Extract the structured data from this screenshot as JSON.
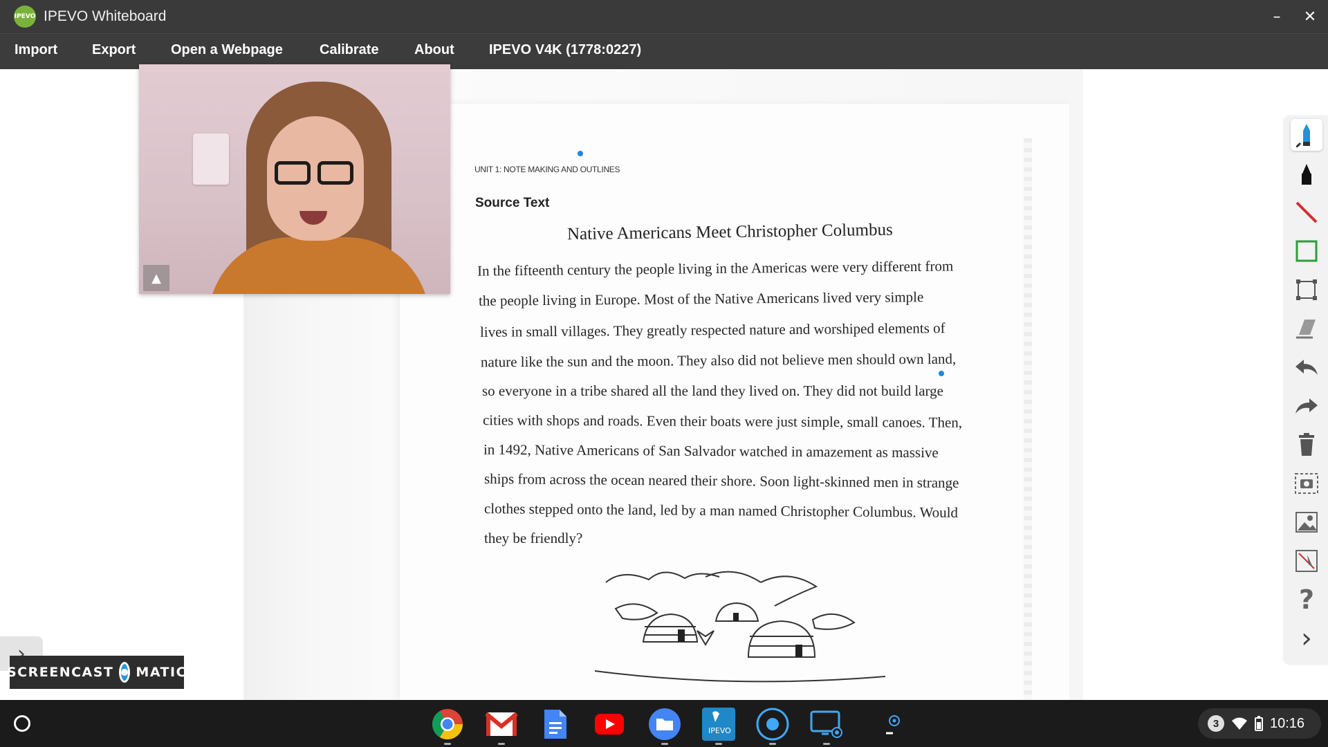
{
  "window": {
    "logo_text": "IPEVO",
    "title": "IPEVO Whiteboard",
    "minimize_glyph": "–",
    "close_glyph": "✕"
  },
  "menu": {
    "items": [
      "Import",
      "Export",
      "Open a Webpage",
      "Calibrate",
      "About",
      "IPEVO V4K (1778:0227)"
    ]
  },
  "document": {
    "unit_header": "UNIT 1: NOTE MAKING AND OUTLINES",
    "section_heading": "Source Text",
    "title": "Native Americans Meet Christopher Columbus",
    "lines": [
      "In the fifteenth century the people living in the Americas were very different from",
      "the people living in Europe. Most of the Native Americans lived very simple",
      "lives in small villages. They greatly respected nature and worshiped elements of",
      "nature like the sun and the moon. They also did not believe men should own land,",
      "so everyone in a tribe shared all the land they lived on. They did not build large",
      "cities with shops and roads. Even their boats were just simple, small canoes. Then,",
      "in 1492, Native Americans of San Salvador watched in amazement as massive",
      "ships from across the ocean neared their shore. Soon light-skinned men in strange",
      "clothes stepped onto the land, led by a man named Christopher Columbus. Would",
      "they be friendly?"
    ],
    "illustration": "village-igloo-huts-drawing"
  },
  "webcam": {
    "toggle_glyph": "▲",
    "content": "presenter-video"
  },
  "toolbar": {
    "tools": [
      {
        "name": "pencil-icon",
        "active": true
      },
      {
        "name": "marker-icon",
        "active": false
      },
      {
        "name": "line-icon",
        "active": false
      },
      {
        "name": "rectangle-icon",
        "active": false
      },
      {
        "name": "selection-icon",
        "active": false
      },
      {
        "name": "eraser-icon",
        "active": false
      },
      {
        "name": "undo-icon",
        "active": false
      },
      {
        "name": "redo-icon",
        "active": false
      },
      {
        "name": "trash-icon",
        "active": false
      },
      {
        "name": "capture-icon",
        "active": false
      },
      {
        "name": "image-icon",
        "active": false
      },
      {
        "name": "annotate-icon",
        "active": false
      },
      {
        "name": "help-icon",
        "active": false
      },
      {
        "name": "collapse-icon",
        "active": false
      }
    ],
    "help_glyph": "?",
    "collapse_glyph": "›"
  },
  "side_expand_glyph": "›",
  "watermark": {
    "left": "SCREENCAST",
    "right": "MATIC"
  },
  "taskbar": {
    "apps": [
      "chrome-icon",
      "gmail-icon",
      "docs-icon",
      "youtube-icon",
      "files-icon",
      "ipevo-icon",
      "screencast-icon",
      "screen-capture-icon"
    ],
    "notification_count": "3",
    "time": "10:16"
  },
  "colors": {
    "titlebar": "#3a3a3a",
    "menubar": "#3c3c3c",
    "accent_blue": "#1e88e5",
    "taskbar": "#1b1b1b"
  }
}
